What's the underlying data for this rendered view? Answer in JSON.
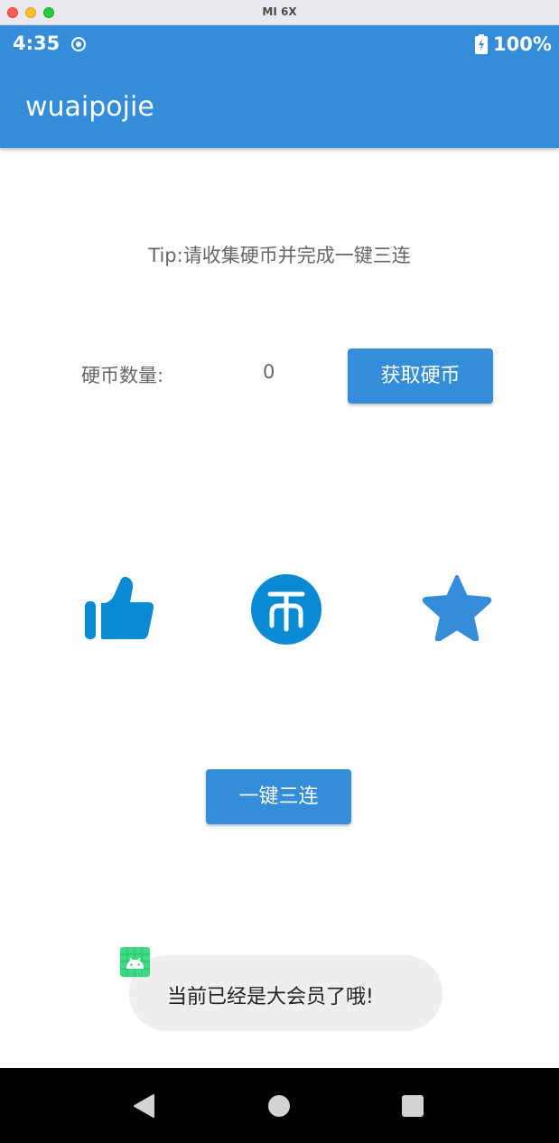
{
  "window": {
    "title": "MI 6X"
  },
  "statusbar": {
    "time": "4:35",
    "battery": "100%"
  },
  "appbar": {
    "title": "wuaipojie"
  },
  "main": {
    "tip": "Tip:请收集硬币并完成一键三连",
    "coin_label": "硬币数量:",
    "coin_value": "0",
    "get_coin_button": "获取硬币",
    "triple_button": "一键三连",
    "icons": [
      "thumbs-up-icon",
      "coin-icon",
      "star-icon"
    ]
  },
  "toast": {
    "text": "当前已经是大会员了哦!"
  },
  "colors": {
    "primary": "#348dd9",
    "like": "#0a8ad3",
    "toast_bg": "#edeeed"
  }
}
